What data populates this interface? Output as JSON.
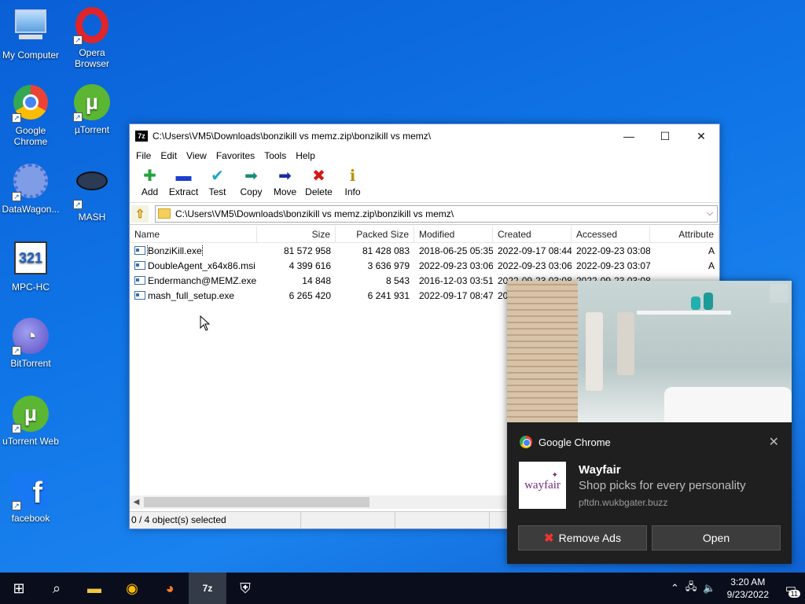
{
  "desktop_icons": [
    {
      "label": "My Computer",
      "icon": "computer-icon"
    },
    {
      "label": "Opera Browser",
      "icon": "opera-icon"
    },
    {
      "label": "Google Chrome",
      "icon": "chrome-icon"
    },
    {
      "label": "µTorrent",
      "icon": "utorrent-icon"
    },
    {
      "label": "DataWagon...",
      "icon": "datawagon-icon"
    },
    {
      "label": "MASH",
      "icon": "mash-icon"
    },
    {
      "label": "MPC-HC",
      "icon": "mpc-hc-icon"
    },
    {
      "label": "BitTorrent",
      "icon": "bittorrent-icon"
    },
    {
      "label": "uTorrent Web",
      "icon": "utorrent-web-icon"
    },
    {
      "label": "facebook",
      "icon": "facebook-icon"
    }
  ],
  "window": {
    "app_icon": "7z",
    "title": "C:\\Users\\VM5\\Downloads\\bonzikill vs memz.zip\\bonzikill vs memz\\",
    "minimize": "—",
    "maximize": "☐",
    "close": "✕",
    "menu": [
      "File",
      "Edit",
      "View",
      "Favorites",
      "Tools",
      "Help"
    ],
    "toolbar": [
      {
        "label": "Add",
        "icon": "plus-icon",
        "glyph": "✚",
        "color": "#22a33a"
      },
      {
        "label": "Extract",
        "icon": "minus-icon",
        "glyph": "▬",
        "color": "#1c3fd1"
      },
      {
        "label": "Test",
        "icon": "check-icon",
        "glyph": "✔",
        "color": "#1aa6c9"
      },
      {
        "label": "Copy",
        "icon": "copy-arrow-icon",
        "glyph": "➡",
        "color": "#1b8e7a"
      },
      {
        "label": "Move",
        "icon": "move-arrow-icon",
        "glyph": "➡",
        "color": "#1c2f9e"
      },
      {
        "label": "Delete",
        "icon": "delete-x-icon",
        "glyph": "✖",
        "color": "#d11919"
      },
      {
        "label": "Info",
        "icon": "info-icon",
        "glyph": "ℹ",
        "color": "#b8940b"
      }
    ],
    "address": "C:\\Users\\VM5\\Downloads\\bonzikill vs memz.zip\\bonzikill vs memz\\",
    "columns": [
      "Name",
      "Size",
      "Packed Size",
      "Modified",
      "Created",
      "Accessed",
      "Attribute"
    ],
    "files": [
      {
        "name": "BonziKill.exe",
        "size": "81 572 958",
        "packed": "81 428 083",
        "modified": "2018-06-25 05:35",
        "created": "2022-09-17 08:44",
        "accessed": "2022-09-23 03:08",
        "attr": "A"
      },
      {
        "name": "DoubleAgent_x64x86.msi",
        "size": "4 399 616",
        "packed": "3 636 979",
        "modified": "2022-09-23 03:06",
        "created": "2022-09-23 03:06",
        "accessed": "2022-09-23 03:07",
        "attr": "A"
      },
      {
        "name": "Endermanch@MEMZ.exe",
        "size": "14 848",
        "packed": "8 543",
        "modified": "2016-12-03 03:51",
        "created": "2022-09-23 03:08",
        "accessed": "2022-09-23 03:08",
        "attr": ""
      },
      {
        "name": "mash_full_setup.exe",
        "size": "6 265 420",
        "packed": "6 241 931",
        "modified": "2022-09-17 08:47",
        "created": "20",
        "accessed": "",
        "attr": ""
      }
    ],
    "status": "0 / 4 object(s) selected"
  },
  "notification": {
    "app": "Google Chrome",
    "title": "Wayfair",
    "message": "Shop picks for every personality",
    "source": "pftdn.wukbgater.buzz",
    "logo_text": "wayfair",
    "buttons": {
      "remove": "Remove Ads",
      "open": "Open"
    },
    "close": "✕"
  },
  "taskbar": {
    "apps": [
      {
        "icon": "windows-start-icon",
        "glyph": "⊞"
      },
      {
        "icon": "search-icon",
        "glyph": "⌕"
      },
      {
        "icon": "file-explorer-icon",
        "glyph": "▬"
      },
      {
        "icon": "chrome-icon",
        "glyph": "◉"
      },
      {
        "icon": "firefox-icon",
        "glyph": "◕"
      },
      {
        "icon": "7zip-icon",
        "glyph": "7z"
      },
      {
        "icon": "security-shield-icon",
        "glyph": "⛨"
      }
    ],
    "time": "3:20 AM",
    "date": "9/23/2022",
    "notif_count": "11"
  }
}
